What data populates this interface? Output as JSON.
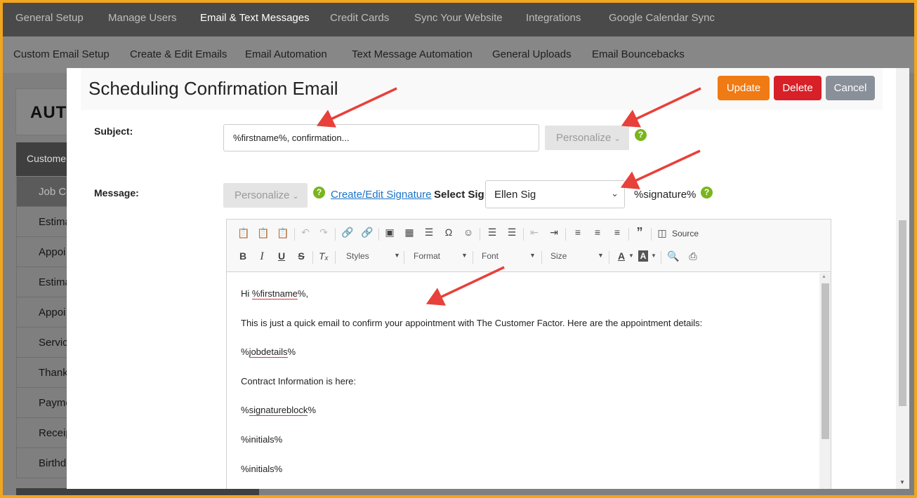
{
  "top_nav": [
    "General Setup",
    "Manage Users",
    "Email & Text Messages",
    "Credit Cards",
    "Sync Your Website",
    "Integrations",
    "Google Calendar Sync"
  ],
  "sub_nav": [
    "Custom Email Setup",
    "Create & Edit Emails",
    "Email Automation",
    "Text Message Automation",
    "General Uploads",
    "Email Bouncebacks"
  ],
  "background": {
    "page_title": "AUTO",
    "sidebar_header": "Custome",
    "sidebar_items": [
      "Job Co",
      "Estima",
      "Appoi",
      "Estima",
      "Appoi",
      "Servic",
      "Thank",
      "Payme",
      "Receip",
      "Birthd"
    ]
  },
  "modal": {
    "title": "Scheduling Confirmation Email",
    "buttons": {
      "update": "Update",
      "delete": "Delete",
      "cancel": "Cancel"
    },
    "subject_label": "Subject:",
    "subject_value": "%firstname%, confirmation...",
    "personalize_label": "Personalize",
    "help_glyph": "?",
    "message_label": "Message:",
    "signature_link": "Create/Edit Signature",
    "select_sig_label": "Select Sig",
    "selected_signature": "Ellen Sig",
    "signature_token": "%signature%"
  },
  "editor": {
    "toolbar": {
      "source_label": "Source",
      "styles_label": "Styles",
      "format_label": "Format",
      "font_label": "Font",
      "size_label": "Size"
    },
    "lines": {
      "l1_pre": "Hi ",
      "l1_token": "%firstname",
      "l1_post": "%,",
      "l2": "This is just a quick email to confirm your appointment with The Customer Factor. Here are the appointment details:",
      "l3_pre": "%",
      "l3_token": "jobdetails",
      "l3_post": "%",
      "l4": "Contract Information is here:",
      "l5_pre": "%",
      "l5_token": "signatureblock",
      "l5_post": "%",
      "l6": "%initials%",
      "l7": "%initials%"
    }
  },
  "colors": {
    "border_frame": "#f2a51e",
    "update": "#f07a14",
    "delete": "#d72027",
    "cancel": "#8a9099",
    "help": "#7ab51d",
    "link": "#1a73c8",
    "arrow": "#e8403a"
  }
}
